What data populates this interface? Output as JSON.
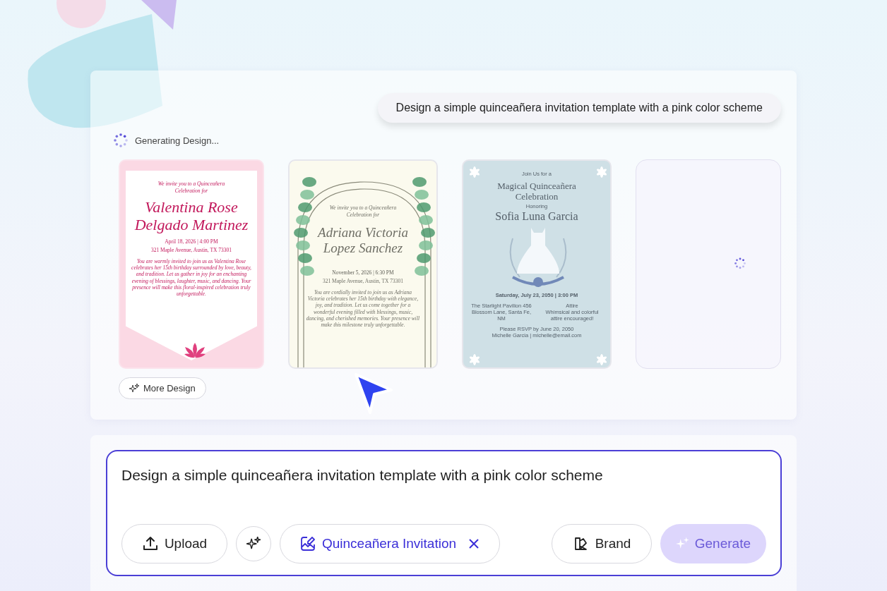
{
  "prompt_bubble": "Design a simple quinceañera invitation template with a pink color scheme",
  "status": {
    "text": "Generating Design..."
  },
  "designs": [
    {
      "kind": "pink",
      "intro": "We invite you to a Quinceañera Celebration for",
      "name": "Valentina Rose Delgado Martinez",
      "date": "April 18, 2026 | 4:00 PM",
      "address": "321 Maple Avenue, Austin, TX 73301",
      "body": "You are warmly invited to join us as Valentina Rose celebrates her 15th birthday surrounded by love, beauty, and tradition. Let us gather in joy for an enchanting evening of blessings, laughter, music, and dancing. Your presence will make this floral-inspired celebration truly unforgettable."
    },
    {
      "kind": "green",
      "intro": "We invite you to a Quinceañera Celebration for",
      "name": "Adriana Victoria Lopez Sanchez",
      "date": "November 5, 2026 | 6:30 PM",
      "address": "321 Maple Avenue, Austin, TX 73301",
      "body": "You are cordially invited to join us as Adriana Victoria celebrates her 15th birthday with elegance, joy, and tradition. Let us come together for a wonderful evening filled with blessings, music, dancing, and cherished memories. Your presence will make this milestone truly unforgettable."
    },
    {
      "kind": "blue",
      "intro": "Join Us for a",
      "title": "Magical Quinceañera Celebration",
      "honoring": "Honoring",
      "name": "Sofia Luna Garcia",
      "date": "Saturday, July 23, 2050 | 3:00 PM",
      "venue": "The Starlight Pavilion 456 Blossom Lane, Santa Fe, NM",
      "attire_label": "Attire",
      "attire": "Whimsical and colorful attire encouraged!",
      "rsvp": "Please RSVP by June 20, 2050",
      "contact": "Michelle Garcia | michelle@email.com"
    },
    {
      "kind": "loading"
    }
  ],
  "more_button": "More Design",
  "composer": {
    "value": "Design a simple quinceañera invitation template with a pink color scheme",
    "upload": "Upload",
    "chip": "Quinceañera Invitation",
    "brand": "Brand",
    "generate": {
      "label": "Generate",
      "disabled": true
    }
  }
}
